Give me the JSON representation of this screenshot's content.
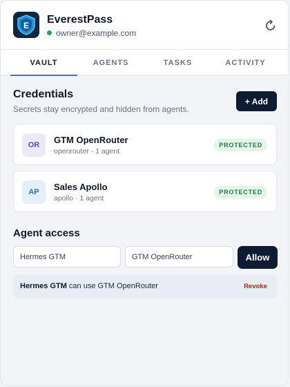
{
  "header": {
    "app_name": "EverestPass",
    "logo_letter": "E",
    "user_email": "owner@example.com",
    "status_color": "#22a55a"
  },
  "icons": {
    "logo": "shield-logo-icon",
    "refresh": "refresh-icon"
  },
  "tabs": [
    {
      "label": "VAULT",
      "active": true
    },
    {
      "label": "AGENTS",
      "active": false
    },
    {
      "label": "TASKS",
      "active": false
    },
    {
      "label": "ACTIVITY",
      "active": false
    }
  ],
  "credentials": {
    "title": "Credentials",
    "subtitle": "Secrets stay encrypted and hidden from agents.",
    "add_label": "+ Add",
    "items": [
      {
        "initials": "OR",
        "name": "GTM OpenRouter",
        "meta": "openrouter · 1 agent",
        "badge": "PROTECTED",
        "avatar_bg": "#ede9fb",
        "avatar_fg": "#5b4ab8"
      },
      {
        "initials": "AP",
        "name": "Sales Apollo",
        "meta": "apollo · 1 agent",
        "badge": "PROTECTED",
        "avatar_bg": "#e3effc",
        "avatar_fg": "#2f6fc4"
      }
    ]
  },
  "agent_access": {
    "title": "Agent access",
    "agent_value": "Hermes GTM",
    "credential_value": "GTM OpenRouter",
    "allow_label": "Allow",
    "grants": [
      {
        "agent": "Hermes GTM",
        "text": "can use GTM OpenRouter",
        "action": "Revoke"
      }
    ]
  },
  "colors": {
    "primary_dark": "#0f1b33",
    "accent": "#3b6fd4",
    "protected_bg": "#e6f5ea",
    "protected_fg": "#1f7a3e",
    "revoke": "#b42318"
  }
}
